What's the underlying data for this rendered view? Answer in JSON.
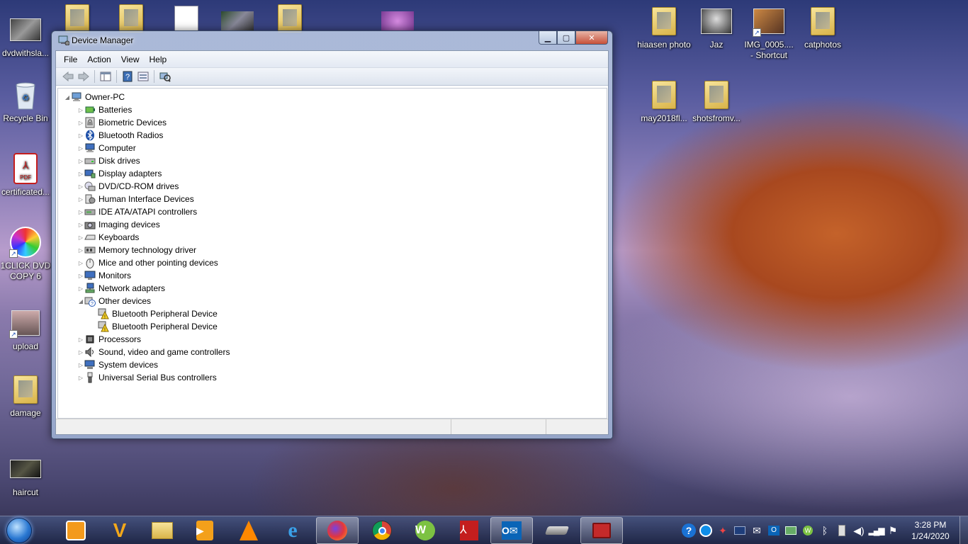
{
  "desktop": {
    "icons_left": [
      {
        "label": "dvdwithsla...",
        "icon": "video-thumbnail-icon"
      },
      {
        "label": "Recycle Bin",
        "icon": "recycle-bin-icon"
      },
      {
        "label": "certificated...",
        "icon": "pdf-file-icon"
      },
      {
        "label": "1CLICK DVD COPY 6",
        "icon": "dvd-copy-app-icon"
      },
      {
        "label": "upload",
        "icon": "photo-shortcut-icon"
      },
      {
        "label": "damage",
        "icon": "folder-icon"
      },
      {
        "label": "haircut",
        "icon": "video-thumbnail-icon"
      }
    ],
    "icons_right": [
      {
        "label": "hiaasen photo",
        "icon": "folder-icon"
      },
      {
        "label": "Jaz",
        "icon": "cat-photo-icon"
      },
      {
        "label": "IMG_0005.... - Shortcut",
        "icon": "photo-shortcut-icon"
      },
      {
        "label": "catphotos",
        "icon": "folder-icon"
      },
      {
        "label": "may2018fl...",
        "icon": "folder-icon"
      },
      {
        "label": "shotsfromv...",
        "icon": "folder-icon"
      }
    ]
  },
  "window": {
    "title": "Device Manager",
    "buttons": {
      "minimize": "▁",
      "maximize": "▢",
      "close": "✕"
    },
    "menu": [
      "File",
      "Action",
      "View",
      "Help"
    ],
    "toolbar": [
      "back-icon",
      "forward-icon",
      "properties-pane-icon",
      "help-icon",
      "update-driver-icon",
      "scan-hardware-icon"
    ],
    "tree": {
      "root": "Owner-PC",
      "categories": [
        {
          "label": "Batteries",
          "icon": "battery-icon",
          "expanded": false
        },
        {
          "label": "Biometric Devices",
          "icon": "fingerprint-icon",
          "expanded": false
        },
        {
          "label": "Bluetooth Radios",
          "icon": "bluetooth-icon",
          "expanded": false
        },
        {
          "label": "Computer",
          "icon": "computer-icon",
          "expanded": false
        },
        {
          "label": "Disk drives",
          "icon": "disk-drive-icon",
          "expanded": false
        },
        {
          "label": "Display adapters",
          "icon": "display-adapter-icon",
          "expanded": false
        },
        {
          "label": "DVD/CD-ROM drives",
          "icon": "dvd-drive-icon",
          "expanded": false
        },
        {
          "label": "Human Interface Devices",
          "icon": "hid-icon",
          "expanded": false
        },
        {
          "label": "IDE ATA/ATAPI controllers",
          "icon": "ide-controller-icon",
          "expanded": false
        },
        {
          "label": "Imaging devices",
          "icon": "camera-icon",
          "expanded": false
        },
        {
          "label": "Keyboards",
          "icon": "keyboard-icon",
          "expanded": false
        },
        {
          "label": "Memory technology driver",
          "icon": "memory-icon",
          "expanded": false
        },
        {
          "label": "Mice and other pointing devices",
          "icon": "mouse-icon",
          "expanded": false
        },
        {
          "label": "Monitors",
          "icon": "monitor-icon",
          "expanded": false
        },
        {
          "label": "Network adapters",
          "icon": "network-adapter-icon",
          "expanded": false
        },
        {
          "label": "Other devices",
          "icon": "unknown-device-icon",
          "expanded": true,
          "children": [
            {
              "label": "Bluetooth Peripheral Device",
              "icon": "warning-device-icon"
            },
            {
              "label": "Bluetooth Peripheral Device",
              "icon": "warning-device-icon"
            }
          ]
        },
        {
          "label": "Processors",
          "icon": "processor-icon",
          "expanded": false
        },
        {
          "label": "Sound, video and game controllers",
          "icon": "speaker-icon",
          "expanded": false
        },
        {
          "label": "System devices",
          "icon": "system-devices-icon",
          "expanded": false
        },
        {
          "label": "Universal Serial Bus controllers",
          "icon": "usb-icon",
          "expanded": false
        }
      ]
    }
  },
  "taskbar": {
    "apps": [
      {
        "name": "outlook-calendar",
        "icon": "outlook-icon",
        "active": false
      },
      {
        "name": "vegas-video",
        "icon": "v-app-icon",
        "active": false
      },
      {
        "name": "file-explorer",
        "icon": "explorer-icon",
        "active": false
      },
      {
        "name": "media-player",
        "icon": "media-player-icon",
        "active": false
      },
      {
        "name": "vlc",
        "icon": "vlc-icon",
        "active": false
      },
      {
        "name": "internet-explorer",
        "icon": "ie-icon",
        "active": false
      },
      {
        "name": "firefox",
        "icon": "firefox-icon",
        "active": true
      },
      {
        "name": "chrome",
        "icon": "chrome-icon",
        "active": false
      },
      {
        "name": "w-app",
        "icon": "w-app-icon",
        "active": false
      },
      {
        "name": "acrobat",
        "icon": "acrobat-icon",
        "active": false
      },
      {
        "name": "outlook",
        "icon": "outlook-mail-icon",
        "active": true
      },
      {
        "name": "scanner",
        "icon": "scanner-icon",
        "active": false
      },
      {
        "name": "device-manager",
        "icon": "toolbox-icon",
        "active": true
      }
    ],
    "tray_icons": [
      "help-icon",
      "teamviewer-icon",
      "tray-app-icon",
      "tray-monitor-icon",
      "mail-icon",
      "outlook-tray-icon",
      "sync-icon",
      "w-tray-icon",
      "bluetooth-icon",
      "usb-eject-icon",
      "volume-icon",
      "signal-icon",
      "flag-icon"
    ],
    "clock": {
      "time": "3:28 PM",
      "date": "1/24/2020"
    }
  }
}
